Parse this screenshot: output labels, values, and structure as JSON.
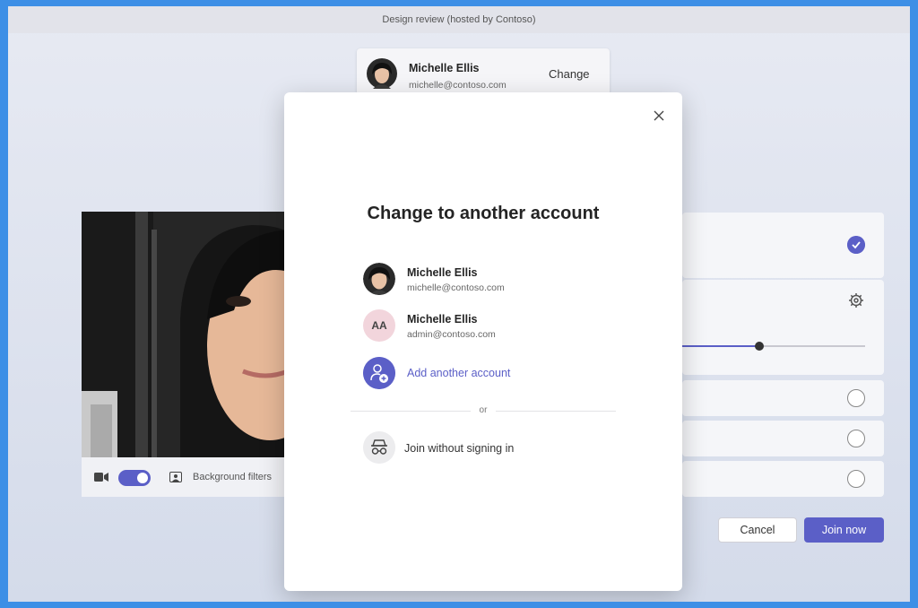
{
  "window": {
    "title": "Design review (hosted by Contoso)"
  },
  "current_account": {
    "name": "Michelle Ellis",
    "email": "michelle@contoso.com",
    "change_label": "Change"
  },
  "video_controls": {
    "camera_on": true,
    "background_filters_label": "Background filters"
  },
  "audio_panel": {
    "volume_level_fraction": 0.42
  },
  "actions": {
    "cancel_label": "Cancel",
    "join_label": "Join now"
  },
  "modal": {
    "title": "Change to another account",
    "accounts": [
      {
        "name": "Michelle Ellis",
        "email": "michelle@contoso.com",
        "avatar": "photo"
      },
      {
        "name": "Michelle Ellis",
        "email": "admin@contoso.com",
        "initials": "AA"
      }
    ],
    "add_account_label": "Add another account",
    "or_label": "or",
    "join_without_label": "Join without signing in"
  },
  "colors": {
    "accent": "#5b5fc7",
    "border_blue": "#3d8fe6"
  }
}
